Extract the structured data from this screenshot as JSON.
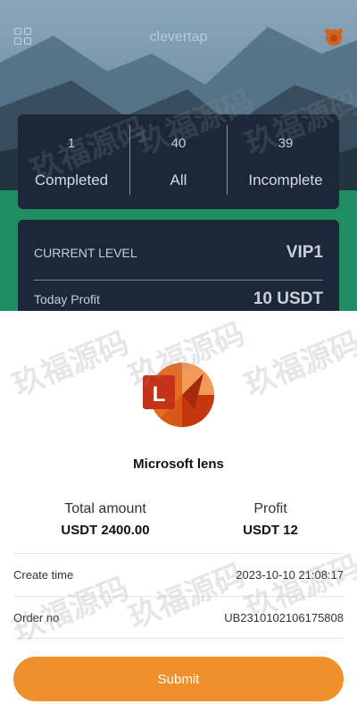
{
  "header": {
    "brand": "clevertap",
    "menu_icon": "grid-icon",
    "avatar_icon": "avatar-icon"
  },
  "stats": [
    {
      "value": "1",
      "label": "Completed"
    },
    {
      "value": "40",
      "label": "All"
    },
    {
      "value": "39",
      "label": "Incomplete"
    }
  ],
  "level_card": {
    "level_label": "CURRENT LEVEL",
    "level_value": "VIP1",
    "profit_label": "Today Profit",
    "profit_value": "10 USDT"
  },
  "task": {
    "app_icon": "microsoft-lens-logo",
    "app_name": "Microsoft lens",
    "total_amount_label": "Total amount",
    "total_amount_value": "USDT 2400.00",
    "profit_label": "Profit",
    "profit_value": "USDT 12",
    "create_time_label": "Create time",
    "create_time_value": "2023-10-10 21:08:17",
    "order_no_label": "Order no",
    "order_no_value": "UB2310102106175808",
    "submit_label": "Submit"
  },
  "watermark": "玖福源码",
  "colors": {
    "card_bg": "#1c2838",
    "accent": "#f0902d",
    "green_band": "#1f8f62"
  }
}
